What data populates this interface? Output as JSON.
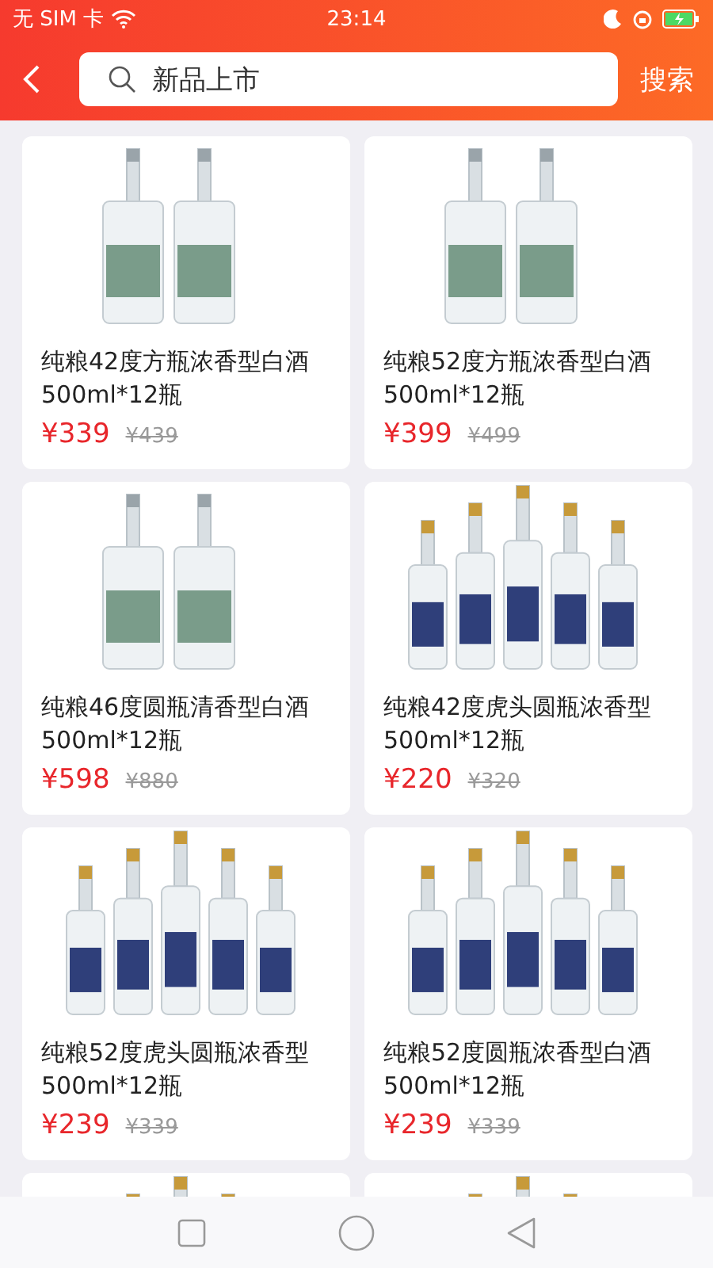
{
  "status_bar": {
    "carrier": "无 SIM 卡",
    "time": "23:14"
  },
  "header": {
    "search": {
      "value": "新品上市"
    },
    "search_button": "搜索"
  },
  "products": [
    {
      "name": "纯粮42度方瓶浓香型白酒500ml*12瓶",
      "price": "¥339",
      "original_price": "¥439",
      "kind": "pair"
    },
    {
      "name": "纯粮52度方瓶浓香型白酒500ml*12瓶",
      "price": "¥399",
      "original_price": "¥499",
      "kind": "pair"
    },
    {
      "name": "纯粮46度圆瓶清香型白酒500ml*12瓶",
      "price": "¥598",
      "original_price": "¥880",
      "kind": "pair"
    },
    {
      "name": "纯粮42度虎头圆瓶浓香型500ml*12瓶",
      "price": "¥220",
      "original_price": "¥320",
      "kind": "row"
    },
    {
      "name": "纯粮52度虎头圆瓶浓香型500ml*12瓶",
      "price": "¥239",
      "original_price": "¥339",
      "kind": "row"
    },
    {
      "name": "纯粮52度圆瓶浓香型白酒500ml*12瓶",
      "price": "¥239",
      "original_price": "¥339",
      "kind": "row"
    }
  ],
  "partial_products": [
    {
      "kind": "row"
    },
    {
      "kind": "row"
    }
  ]
}
